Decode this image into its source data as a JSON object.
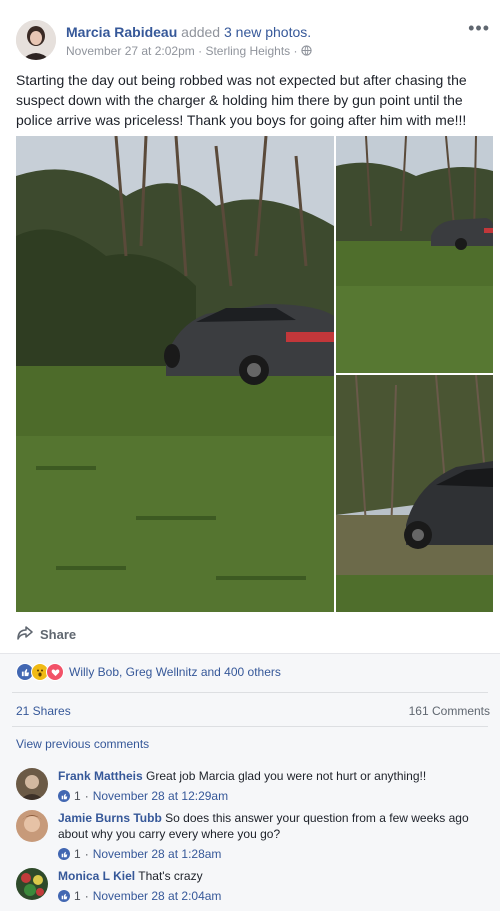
{
  "post": {
    "author": "Marcia Rabideau",
    "action": "added",
    "photo_count_label": "3 new photos.",
    "timestamp": "November 27 at 2:02pm",
    "separator": "·",
    "location": "Sterling Heights",
    "separator2": "·",
    "menu_icon": "more-horizontal-icon",
    "text": "Starting the day out being robbed was not expected but after chasing the suspect down with the charger & holding him there by gun point until the police arrive was priceless! Thank you boys for going after him with me!!!",
    "share_label": "Share"
  },
  "reactions": {
    "icons": [
      "like",
      "wow",
      "love"
    ],
    "summary": "Willy Bob, Greg Wellnitz and 400 others",
    "colors": {
      "like": "#4267b2",
      "wow": "#f0ba15",
      "love": "#f25268"
    }
  },
  "stats": {
    "shares": "21 Shares",
    "comments": "161 Comments"
  },
  "view_previous": "View previous comments",
  "comments": [
    {
      "name": "Frank Mattheis",
      "text": "Great job Marcia glad you were not hurt or anything!!",
      "likes": "1",
      "sep": "·",
      "time": "November 28 at 12:29am"
    },
    {
      "name": "Jamie Burns Tubb",
      "text": "So does this answer your question from a few weeks ago about why you carry every where you go?",
      "likes": "1",
      "sep": "·",
      "time": "November 28 at 1:28am"
    },
    {
      "name": "Monica L Kiel",
      "text": "That's crazy",
      "likes": "1",
      "sep": "·",
      "time": "November 28 at 2:04am"
    }
  ]
}
